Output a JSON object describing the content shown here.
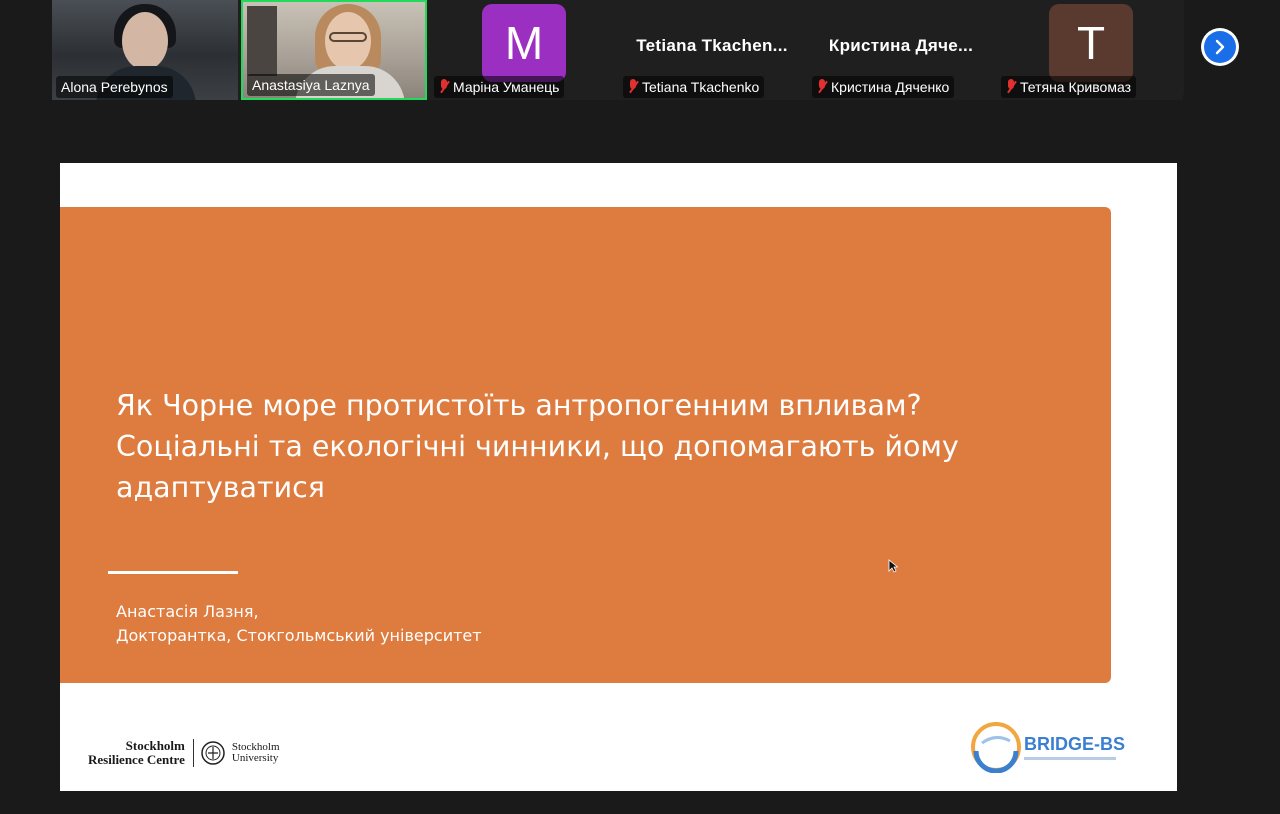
{
  "participants": [
    {
      "name": "Alona Perebynos",
      "type": "video",
      "muted": false
    },
    {
      "name": "Anastasiya Laznya",
      "type": "video",
      "muted": false,
      "active_speaker": true
    },
    {
      "name": "Маріна Уманець",
      "type": "avatar",
      "initial": "M",
      "avatar_color": "#9b2fc2",
      "muted": true
    },
    {
      "name": "Tetiana Tkachenko",
      "type": "name",
      "display_name": "Tetiana  Tkachen...",
      "muted": true
    },
    {
      "name": "Кристина Дяченко",
      "type": "name",
      "display_name": "Кристина  Дяче...",
      "muted": true
    },
    {
      "name": "Тетяна Кривомаз",
      "type": "avatar",
      "initial": "T",
      "avatar_color": "#5a3a2e",
      "muted": true
    }
  ],
  "next_button_icon": "chevron-right-icon",
  "slide": {
    "title": "Як Чорне море протистоїть антропогенним впливам? Соціальні та екологічні чинники, що допомагають йому адаптуватися",
    "author_name": "Анастасія Лазня,",
    "author_role": "Докторантка, Стокгольмський університет",
    "logo_left_line1": "Stockholm",
    "logo_left_line2": "Resilience Centre",
    "logo_right_line1": "Stockholm",
    "logo_right_line2": "University",
    "logo_bridge": "BRIDGE-BS",
    "panel_color": "#de7b3e"
  },
  "colors": {
    "active_speaker_border": "#23d959",
    "mute_icon": "#e03030",
    "next_button": "#1a6ee8"
  }
}
